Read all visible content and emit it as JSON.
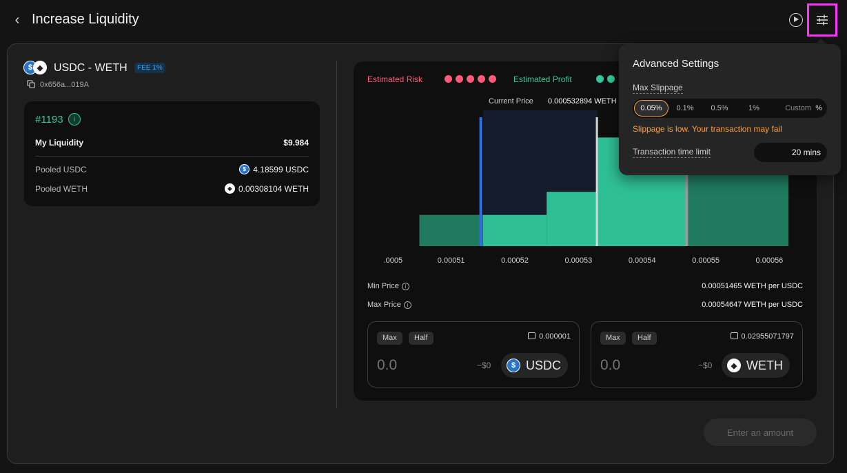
{
  "header": {
    "title": "Increase Liquidity"
  },
  "pool": {
    "pair": "USDC - WETH",
    "fee": "FEE 1%",
    "address": "0x656a...019A",
    "token0_icon": "usdc-icon",
    "token1_icon": "weth-icon"
  },
  "position": {
    "id": "#1193",
    "liquidity_label": "My Liquidity",
    "liquidity_value": "$9.984",
    "pooled": [
      {
        "label": "Pooled USDC",
        "value": "4.18599 USDC",
        "icon": "usdc-icon"
      },
      {
        "label": "Pooled WETH",
        "value": "0.00308104 WETH",
        "icon": "weth-icon"
      }
    ]
  },
  "chart": {
    "risk_label": "Estimated Risk",
    "profit_label": "Estimated Profit",
    "risk_dots": 5,
    "current_price_label": "Current Price",
    "current_price_value": "0.000532894 WETH"
  },
  "chart_data": {
    "type": "bar",
    "title": "",
    "xlabel": "",
    "ylabel": "",
    "x_ticks": [
      ".0005",
      "0.00051",
      "0.00052",
      "0.00053",
      "0.00054",
      "0.00055",
      "0.00056"
    ],
    "x_tick_values": [
      0.0005,
      0.00051,
      0.00052,
      0.00053,
      0.00054,
      0.00055,
      0.00056
    ],
    "xlim": [
      0.0005,
      0.00056
    ],
    "series": [
      {
        "values": [
          {
            "x0": 0.000505,
            "x1": 0.000515,
            "y": 0.23
          },
          {
            "x0": 0.000515,
            "x1": 0.000525,
            "y": 0.23
          },
          {
            "x0": 0.000525,
            "x1": 0.000533,
            "y": 0.4
          },
          {
            "x0": 0.000533,
            "x1": 0.000547,
            "y": 0.8
          },
          {
            "x0": 0.000547,
            "x1": 0.000563,
            "y": 0.8
          }
        ]
      },
      {
        "values": [
          {
            "x0": 0.000515,
            "x1": 0.000533,
            "y": 1.0
          }
        ]
      }
    ],
    "min_price": 0.00051465,
    "max_price": 0.00054647,
    "current_price": 0.000532894,
    "max_price_marker": 0.000547,
    "colors": {
      "liquidity": "#1f7a5e",
      "range": "#2fbf95",
      "selection": "#141b2a",
      "min_line": "#2f6fe6",
      "current_line": "#d9d9d9",
      "max_line": "#9a9a9a"
    }
  },
  "prices": {
    "min_label": "Min Price",
    "min_value": "0.00051465 WETH per USDC",
    "max_label": "Max Price",
    "max_value": "0.00054647 WETH per USDC"
  },
  "inputs": [
    {
      "max": "Max",
      "half": "Half",
      "balance": "0.000001",
      "amount_placeholder": "0.0",
      "usd": "~$0",
      "token": "USDC",
      "icon": "usdc-icon"
    },
    {
      "max": "Max",
      "half": "Half",
      "balance": "0.02955071797",
      "amount_placeholder": "0.0",
      "usd": "~$0",
      "token": "WETH",
      "icon": "weth-icon"
    }
  ],
  "submit": {
    "label": "Enter an amount"
  },
  "settings": {
    "title": "Advanced Settings",
    "max_slippage_label": "Max Slippage",
    "slippage_options": [
      "0.05%",
      "0.1%",
      "0.5%",
      "1%"
    ],
    "selected_slippage": "0.05%",
    "custom_placeholder": "Custom",
    "custom_suffix": "%",
    "warning": "Slippage is low. Your transaction may fail",
    "time_limit_label": "Transaction time limit",
    "time_limit_value": "20 mins",
    "accent_color": "#ff9e3d"
  }
}
